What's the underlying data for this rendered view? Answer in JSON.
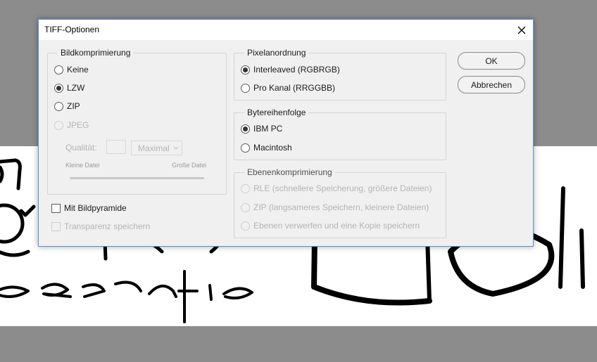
{
  "dialog": {
    "title": "TIFF-Optionen",
    "close_icon": "close-icon"
  },
  "compression": {
    "legend": "Bildkomprimierung",
    "options": [
      {
        "label": "Keine",
        "selected": false,
        "enabled": true
      },
      {
        "label": "LZW",
        "selected": true,
        "enabled": true
      },
      {
        "label": "ZIP",
        "selected": false,
        "enabled": true
      },
      {
        "label": "JPEG",
        "selected": false,
        "enabled": false
      }
    ],
    "quality_label": "Qualität:",
    "quality_value": "",
    "quality_preset": "Maximal",
    "small_file_label": "Kleine Datei",
    "large_file_label": "Große Datei"
  },
  "pyramid": {
    "label": "Mit Bildpyramide",
    "checked": false,
    "enabled": true
  },
  "transparency": {
    "label": "Transparenz speichern",
    "checked": false,
    "enabled": false
  },
  "pixel_order": {
    "legend": "Pixelanordnung",
    "options": [
      {
        "label": "Interleaved (RGBRGB)",
        "selected": true
      },
      {
        "label": "Pro Kanal (RRGGBB)",
        "selected": false
      }
    ]
  },
  "byte_order": {
    "legend": "Bytereihenfolge",
    "options": [
      {
        "label": "IBM PC",
        "selected": true
      },
      {
        "label": "Macintosh",
        "selected": false
      }
    ]
  },
  "layer_compression": {
    "legend": "Ebenenkomprimierung",
    "options": [
      {
        "label": "RLE (schnellere Speicherung, größere Dateien)",
        "enabled": false
      },
      {
        "label": "ZIP (langsameres Speichern, kleinere Dateien)",
        "enabled": false
      },
      {
        "label": "Ebenen verwerfen und eine Kopie speichern",
        "enabled": false
      }
    ]
  },
  "buttons": {
    "ok": "OK",
    "cancel": "Abbrechen"
  },
  "colors": {
    "dialog_border": "#5a8fd0",
    "workspace_bg": "#8c8c8c",
    "disabled_text": "#b4b4b4"
  }
}
